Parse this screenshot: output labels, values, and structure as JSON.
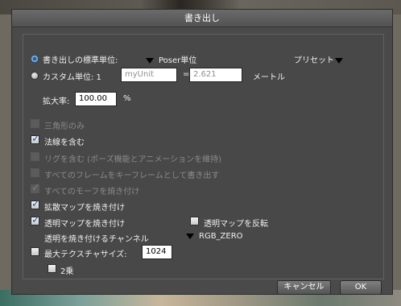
{
  "dialog": {
    "title": "書き出し"
  },
  "units": {
    "standard_label": "書き出しの標準単位:",
    "standard_value": "Poser単位",
    "preset_label": "プリセット",
    "custom_label": "カスタム単位: 1",
    "custom_name": "myUnit",
    "equals": "=",
    "custom_value": "2.621",
    "meter_label": "メートル"
  },
  "scale": {
    "label": "拡大率:",
    "value": "100.00",
    "unit": "%"
  },
  "options": [
    {
      "label": "三角形のみ",
      "checked": false,
      "enabled": false
    },
    {
      "label": "法線を含む",
      "checked": true,
      "enabled": true
    },
    {
      "label": "リグを含む (ポーズ機能とアニメーションを維持)",
      "checked": false,
      "enabled": false
    },
    {
      "label": "すべてのフレームをキーフレームとして書き出す",
      "checked": false,
      "enabled": false
    },
    {
      "label": "すべてのモーフを焼き付け",
      "checked": true,
      "enabled": false
    },
    {
      "label": "拡散マップを焼き付け",
      "checked": true,
      "enabled": true
    },
    {
      "label": "透明マップを焼き付け",
      "checked": true,
      "enabled": true
    }
  ],
  "invert_transparency": {
    "label": "透明マップを反転",
    "checked": false
  },
  "channel": {
    "label": "透明を焼き付けるチャンネル",
    "value": "RGB_ZERO"
  },
  "max_texture": {
    "label": "最大テクスチャサイズ:",
    "value": "1024",
    "checked": false
  },
  "power_of_two": {
    "label": "2乗",
    "checked": false
  },
  "buttons": {
    "cancel": "キャンセル",
    "ok": "OK"
  }
}
